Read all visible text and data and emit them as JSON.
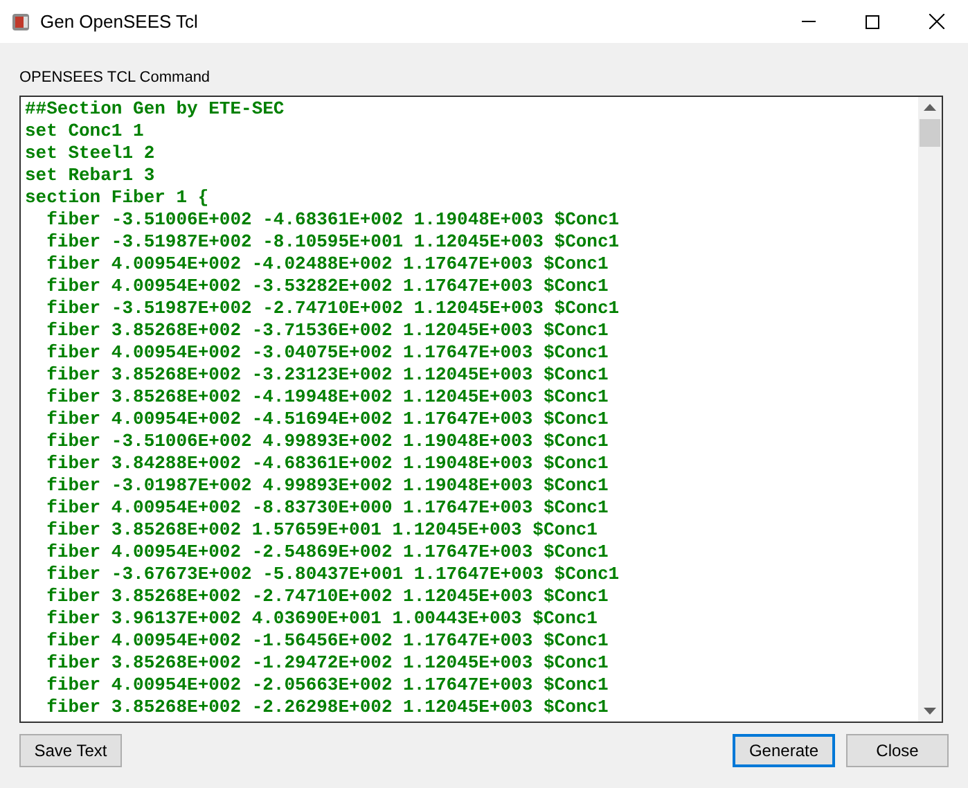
{
  "window": {
    "title": "Gen OpenSEES Tcl"
  },
  "label": "OPENSEES TCL Command",
  "lines": [
    "##Section Gen by ETE-SEC",
    "set Conc1 1",
    "set Steel1 2",
    "set Rebar1 3",
    "section Fiber 1 {",
    "  fiber -3.51006E+002 -4.68361E+002 1.19048E+003 $Conc1",
    "  fiber -3.51987E+002 -8.10595E+001 1.12045E+003 $Conc1",
    "  fiber 4.00954E+002 -4.02488E+002 1.17647E+003 $Conc1",
    "  fiber 4.00954E+002 -3.53282E+002 1.17647E+003 $Conc1",
    "  fiber -3.51987E+002 -2.74710E+002 1.12045E+003 $Conc1",
    "  fiber 3.85268E+002 -3.71536E+002 1.12045E+003 $Conc1",
    "  fiber 4.00954E+002 -3.04075E+002 1.17647E+003 $Conc1",
    "  fiber 3.85268E+002 -3.23123E+002 1.12045E+003 $Conc1",
    "  fiber 3.85268E+002 -4.19948E+002 1.12045E+003 $Conc1",
    "  fiber 4.00954E+002 -4.51694E+002 1.17647E+003 $Conc1",
    "  fiber -3.51006E+002 4.99893E+002 1.19048E+003 $Conc1",
    "  fiber 3.84288E+002 -4.68361E+002 1.19048E+003 $Conc1",
    "  fiber -3.01987E+002 4.99893E+002 1.19048E+003 $Conc1",
    "  fiber 4.00954E+002 -8.83730E+000 1.17647E+003 $Conc1",
    "  fiber 3.85268E+002 1.57659E+001 1.12045E+003 $Conc1",
    "  fiber 4.00954E+002 -2.54869E+002 1.17647E+003 $Conc1",
    "  fiber -3.67673E+002 -5.80437E+001 1.17647E+003 $Conc1",
    "  fiber 3.85268E+002 -2.74710E+002 1.12045E+003 $Conc1",
    "  fiber 3.96137E+002 4.03690E+001 1.00443E+003 $Conc1",
    "  fiber 4.00954E+002 -1.56456E+002 1.17647E+003 $Conc1",
    "  fiber 3.85268E+002 -1.29472E+002 1.12045E+003 $Conc1",
    "  fiber 4.00954E+002 -2.05663E+002 1.17647E+003 $Conc1",
    "  fiber 3.85268E+002 -2.26298E+002 1.12045E+003 $Conc1"
  ],
  "buttons": [
    {
      "label": "Save Text",
      "kind": "left",
      "selected": false
    },
    {
      "label": "Generate",
      "kind": "right",
      "selected": true
    },
    {
      "label": "Close",
      "kind": "right",
      "selected": false
    }
  ]
}
